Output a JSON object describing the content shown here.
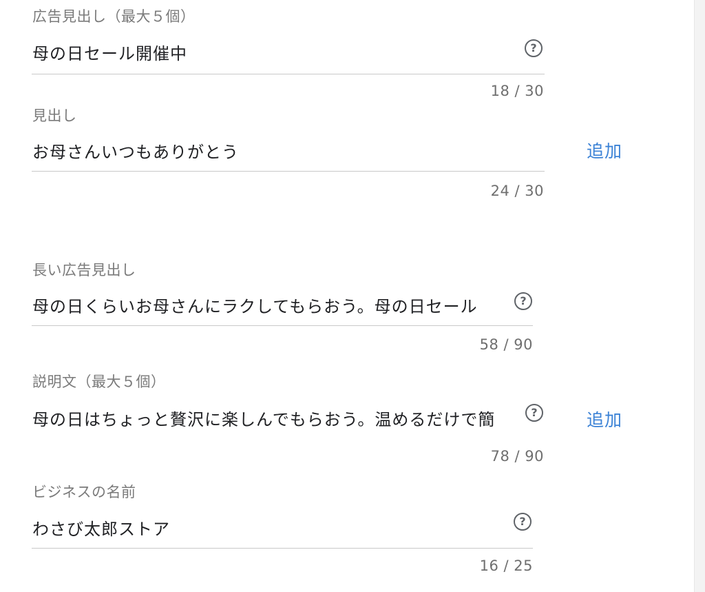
{
  "fields": [
    {
      "label": "広告見出し（最大５個）",
      "value": "母の日セール開催中",
      "counter": "18 / 30"
    },
    {
      "label": "見出し",
      "value": "お母さんいつもありがとう",
      "counter": "24 / 30",
      "add_label": "追加"
    },
    {
      "label": "長い広告見出し",
      "value": "母の日くらいお母さんにラクしてもらおう。母の日セール",
      "counter": "58 / 90"
    },
    {
      "label": "説明文（最大５個）",
      "value": "母の日はちょっと贅沢に楽しんでもらおう。温めるだけで簡",
      "counter": "78 / 90",
      "add_label": "追加"
    },
    {
      "label": "ビジネスの名前",
      "value": "わさび太郎ストア",
      "counter": "16 / 25"
    }
  ],
  "help_glyph": "?",
  "help_icon": "question-circle-icon",
  "colors": {
    "link": "#3b82d6",
    "label": "#7a7a7a",
    "text": "#202124",
    "divider": "#c9c9c9"
  }
}
